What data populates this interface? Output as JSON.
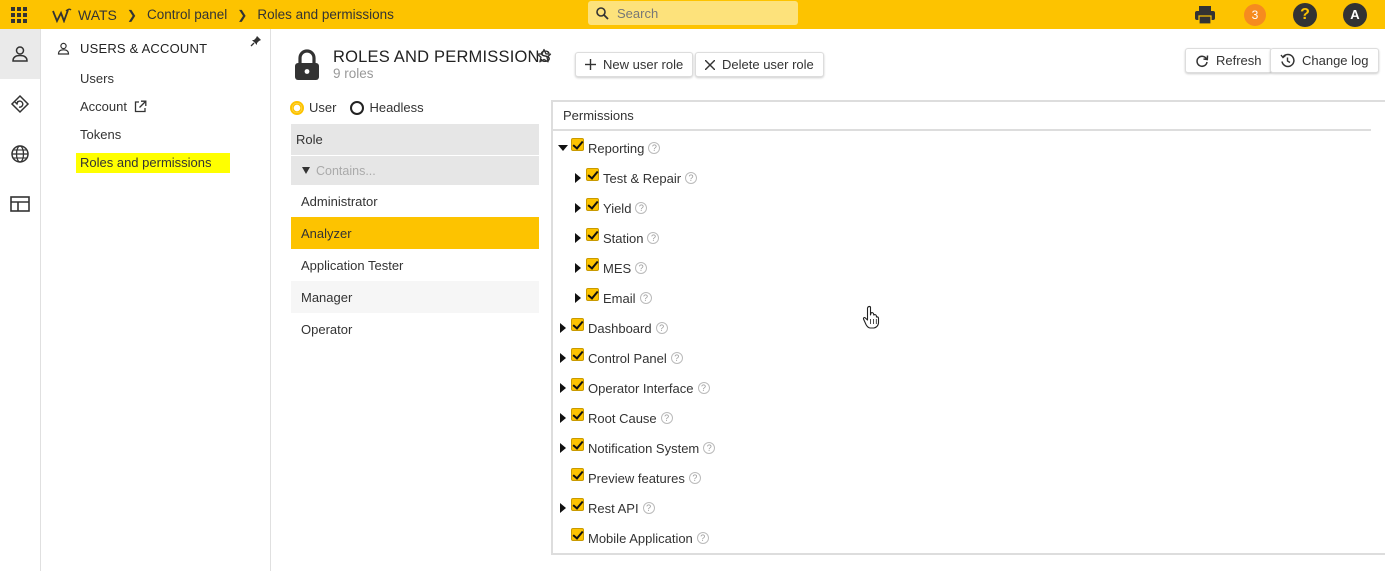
{
  "header": {
    "app_name": "WATS",
    "breadcrumb": [
      "Control panel",
      "Roles and permissions"
    ],
    "search_placeholder": "Search",
    "notification_count": "3",
    "help_label": "?",
    "avatar_initial": "A",
    "accent_color": "#fdc300"
  },
  "rail": {
    "items": [
      "user-icon",
      "history-icon",
      "globe-icon",
      "layout-icon"
    ]
  },
  "nav": {
    "section_title": "USERS & ACCOUNT",
    "links": [
      "Users",
      "Account",
      "Tokens",
      "Roles and permissions"
    ],
    "active_link": "Roles and permissions"
  },
  "page": {
    "title": "ROLES AND PERMISSIONS",
    "subtitle": "9 roles",
    "buttons": {
      "new_role": "New user role",
      "delete_role": "Delete user role",
      "refresh": "Refresh",
      "change_log": "Change log"
    }
  },
  "role_type": {
    "options": [
      "User",
      "Headless"
    ],
    "selected": "User"
  },
  "roles": {
    "column_header": "Role",
    "filter_placeholder": "Contains...",
    "items": [
      "Administrator",
      "Analyzer",
      "Application Tester",
      "Manager",
      "Operator"
    ],
    "selected": "Analyzer"
  },
  "permissions": {
    "header": "Permissions",
    "tree": [
      {
        "label": "Reporting",
        "level": 0,
        "expander": "expanded",
        "checked": true
      },
      {
        "label": "Test & Repair",
        "level": 1,
        "expander": "collapsed",
        "checked": true
      },
      {
        "label": "Yield",
        "level": 1,
        "expander": "collapsed",
        "checked": true
      },
      {
        "label": "Station",
        "level": 1,
        "expander": "collapsed",
        "checked": true
      },
      {
        "label": "MES",
        "level": 1,
        "expander": "collapsed",
        "checked": true
      },
      {
        "label": "Email",
        "level": 1,
        "expander": "collapsed",
        "checked": true
      },
      {
        "label": "Dashboard",
        "level": 0,
        "expander": "collapsed",
        "checked": true
      },
      {
        "label": "Control Panel",
        "level": 0,
        "expander": "collapsed",
        "checked": true
      },
      {
        "label": "Operator Interface",
        "level": 0,
        "expander": "collapsed",
        "checked": true
      },
      {
        "label": "Root Cause",
        "level": 0,
        "expander": "collapsed",
        "checked": true
      },
      {
        "label": "Notification System",
        "level": 0,
        "expander": "collapsed",
        "checked": true
      },
      {
        "label": "Preview features",
        "level": 0,
        "expander": "none",
        "checked": true
      },
      {
        "label": "Rest API",
        "level": 0,
        "expander": "collapsed",
        "checked": true
      },
      {
        "label": "Mobile Application",
        "level": 0,
        "expander": "none",
        "checked": true
      }
    ]
  }
}
